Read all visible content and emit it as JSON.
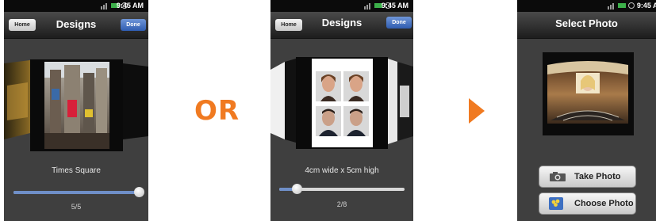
{
  "screen1": {
    "status_time": "9:45 AM",
    "nav": {
      "home_label": "Home",
      "title": "Designs",
      "done_label": "Done"
    },
    "caption": "Times Square",
    "counter": "5/5",
    "slider": {
      "value": 1.0
    }
  },
  "separator_or": "OR",
  "screen2": {
    "status_time": "9:45 AM",
    "nav": {
      "home_label": "Home",
      "title": "Designs",
      "done_label": "Done"
    },
    "caption": "4cm wide x 5cm high",
    "counter": "2/8",
    "slider": {
      "value": 0.14
    }
  },
  "screen3": {
    "status_time": "9:45 AM",
    "nav": {
      "title": "Select Photo"
    },
    "buttons": {
      "take_photo": "Take Photo",
      "choose_photo": "Choose Photo"
    }
  },
  "colors": {
    "accent": "#f07a21",
    "slider_fill": "#6f8fc8",
    "done_button": "#3f6fc4"
  }
}
